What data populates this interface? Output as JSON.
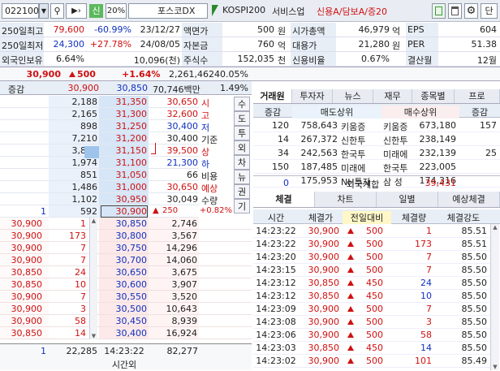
{
  "toolbar": {
    "code": "022100",
    "sin": "신",
    "pct": "20%",
    "name": "포스코DX",
    "index": "KOSPI200",
    "sector": "서비스업",
    "credit": "신용A/담보A/증20",
    "single": "단"
  },
  "info": [
    {
      "l1": "250일최고",
      "v1": "79,600",
      "v2": "-60.99%",
      "v3": "23/12/27",
      "l2": "액면가",
      "v4": "500",
      "u4": "원",
      "l3": "시가총액",
      "v5": "46,979",
      "u5": "억",
      "l4": "EPS",
      "v6": "604"
    },
    {
      "l1": "250일최저",
      "v1": "24,300",
      "v2": "+27.78%",
      "v3": "24/08/05",
      "l2": "자본금",
      "v4": "760",
      "u4": "억",
      "l3": "대용가",
      "v5": "21,280",
      "u5": "원",
      "l4": "PER",
      "v6": "51.38"
    },
    {
      "l1": "외국인보유",
      "v1": "6.64%",
      "v2": "",
      "v3": "10,096(천)",
      "l2": "주식수",
      "v4": "152,035",
      "u4": "천",
      "l3": "신용비율",
      "v5": "0.67%",
      "u5": "",
      "l4": "결산월",
      "v6": "12월"
    }
  ],
  "quote": {
    "price": "30,900",
    "change": "500",
    "rate": "+1.64%",
    "volume": "2,261,462",
    "vol_rate": "40.05%",
    "label_chg": "증감",
    "best_ask": "30,900",
    "best_bid": "30,850",
    "amount": "70,746백만",
    "amount_rate": "1.49%"
  },
  "asks": [
    {
      "q": "2,188",
      "p": "31,350"
    },
    {
      "q": "2,165",
      "p": "31,300"
    },
    {
      "q": "898",
      "p": "31,250"
    },
    {
      "q": "7,210",
      "p": "31,200"
    },
    {
      "q": "3,819",
      "p": "31,150"
    },
    {
      "q": "1,974",
      "p": "31,100"
    },
    {
      "q": "851",
      "p": "31,050"
    },
    {
      "q": "1,486",
      "p": "31,000"
    },
    {
      "q": "1,102",
      "p": "30,950"
    },
    {
      "q": "592",
      "p": "30,900",
      "c": "1"
    }
  ],
  "bids": [
    {
      "p": "30,850",
      "q": "2,746",
      "c": "30,900",
      "d": "1"
    },
    {
      "p": "30,800",
      "q": "3,567",
      "c": "30,900",
      "d": "173"
    },
    {
      "p": "30,750",
      "q": "14,296",
      "c": "30,900",
      "d": "7"
    },
    {
      "p": "30,700",
      "q": "14,060",
      "c": "30,900",
      "d": "7"
    },
    {
      "p": "30,650",
      "q": "3,675",
      "c": "30,850",
      "d": "24"
    },
    {
      "p": "30,600",
      "q": "3,907",
      "c": "30,850",
      "d": "10"
    },
    {
      "p": "30,550",
      "q": "3,520",
      "c": "30,900",
      "d": "7"
    },
    {
      "p": "30,500",
      "q": "10,643",
      "c": "30,900",
      "d": "3"
    },
    {
      "p": "30,450",
      "q": "8,939",
      "c": "30,900",
      "d": "58"
    },
    {
      "p": "30,400",
      "q": "16,924",
      "c": "30,850",
      "d": "14"
    }
  ],
  "mid": [
    {
      "v": "30,650",
      "k": "시"
    },
    {
      "v": "32,600",
      "k": "고"
    },
    {
      "v": "30,400",
      "k": "저"
    },
    {
      "v": "30,400",
      "k": "기준"
    },
    {
      "v": "39,500",
      "k": "상"
    },
    {
      "v": "21,300",
      "k": "하"
    },
    {
      "v": "66",
      "k": "비용"
    },
    {
      "v": "30,650",
      "k": "예상"
    },
    {
      "v": "30,049",
      "k": "수량"
    }
  ],
  "mid_last": {
    "arrow": "▲",
    "v": "250",
    "r": "+0.82%"
  },
  "side_tabs": [
    "수",
    "도",
    "투",
    "외",
    "차",
    "뉴",
    "권",
    "기"
  ],
  "footer": {
    "left": "1",
    "total_ask": "22,285",
    "time": "14:23:22",
    "time_label": "시간외",
    "total_bid": "82,277"
  },
  "broker_tabs": [
    "거래원",
    "투자자",
    "뉴스",
    "재무",
    "종목별",
    "프로"
  ],
  "broker": {
    "h1": "증감",
    "h2": "매도상위",
    "h3": "매수상위",
    "h4": "증감",
    "rows": [
      {
        "a": "120",
        "b": "758,643",
        "c": "키움증",
        "d": "키움증",
        "e": "673,180",
        "f": "157"
      },
      {
        "a": "14",
        "b": "267,372",
        "c": "신한투",
        "d": "신한투",
        "e": "238,149",
        "f": ""
      },
      {
        "a": "34",
        "b": "242,563",
        "c": "한국투",
        "d": "미래에",
        "e": "232,139",
        "f": "25"
      },
      {
        "a": "150",
        "b": "187,485",
        "c": "미래에",
        "d": "한국투",
        "e": "223,005",
        "f": ""
      },
      {
        "a": "",
        "b": "175,953",
        "c": "NH투자",
        "d": "삼 성",
        "e": "174,316",
        "f": ""
      }
    ],
    "foreign": {
      "a": "0",
      "label": "외국계합",
      "b": "39,431"
    }
  },
  "trade_tabs": [
    "체결",
    "차트",
    "일별",
    "예상체결"
  ],
  "trade": {
    "h": [
      "시간",
      "체결가",
      "전일대비",
      "체결량",
      "체결강도"
    ],
    "rows": [
      {
        "t": "14:23:22",
        "p": "30,900",
        "d": "500",
        "q": "1",
        "s": "85.51"
      },
      {
        "t": "14:23:22",
        "p": "30,900",
        "d": "500",
        "q": "173",
        "s": "85.51"
      },
      {
        "t": "14:23:20",
        "p": "30,900",
        "d": "500",
        "q": "7",
        "s": "85.50"
      },
      {
        "t": "14:23:15",
        "p": "30,900",
        "d": "500",
        "q": "7",
        "s": "85.50"
      },
      {
        "t": "14:23:12",
        "p": "30,850",
        "d": "450",
        "q": "24",
        "s": "85.50"
      },
      {
        "t": "14:23:12",
        "p": "30,850",
        "d": "450",
        "q": "10",
        "s": "85.50"
      },
      {
        "t": "14:23:09",
        "p": "30,900",
        "d": "500",
        "q": "7",
        "s": "85.50"
      },
      {
        "t": "14:23:08",
        "p": "30,900",
        "d": "500",
        "q": "3",
        "s": "85.50"
      },
      {
        "t": "14:23:06",
        "p": "30,900",
        "d": "500",
        "q": "58",
        "s": "85.50"
      },
      {
        "t": "14:23:03",
        "p": "30,850",
        "d": "450",
        "q": "14",
        "s": "85.50"
      },
      {
        "t": "14:23:02",
        "p": "30,900",
        "d": "500",
        "q": "101",
        "s": "85.49"
      }
    ]
  }
}
